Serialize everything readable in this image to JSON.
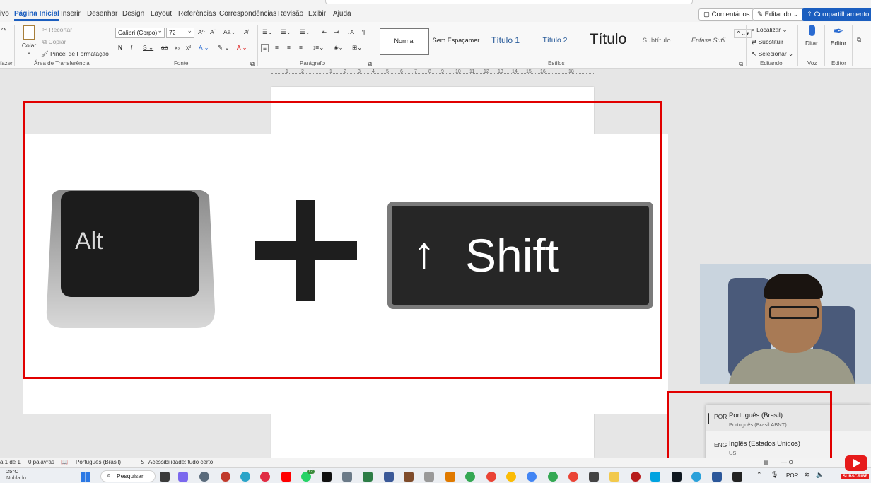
{
  "tabs": [
    "ivo",
    "Página Inicial",
    "Inserir",
    "Desenhar",
    "Design",
    "Layout",
    "Referências",
    "Correspondências",
    "Revisão",
    "Exibir",
    "Ajuda"
  ],
  "ribbon_right": {
    "comments": "Comentários",
    "editing": "Editando",
    "share": "Compartilhamento"
  },
  "clipboard": {
    "paste": "Colar",
    "cut": "Recortar",
    "copy": "Copiar",
    "format_painter": "Pincel de Formatação",
    "group_label": "Área de Transferência",
    "undo_label": "fazer"
  },
  "font": {
    "name": "Calibri (Corpo)",
    "size": "72",
    "group_label": "Fonte"
  },
  "paragraph": {
    "group_label": "Parágrafo"
  },
  "styles": {
    "group_label": "Estilos",
    "items": [
      "Normal",
      "Sem Espaçamer",
      "Título 1",
      "Título 2",
      "Título",
      "Subtítulo",
      "Ênfase Sutil"
    ]
  },
  "editing": {
    "find": "Localizar",
    "replace": "Substituir",
    "select": "Selecionar",
    "group_label": "Editando"
  },
  "voice": {
    "dictate": "Ditar",
    "group_label": "Voz"
  },
  "editor": {
    "label": "Editor",
    "group_label": "Editor"
  },
  "ruler": [
    "1",
    "2",
    "1",
    "2",
    "3",
    "4",
    "5",
    "6",
    "7",
    "8",
    "9",
    "10",
    "11",
    "12",
    "13",
    "14",
    "15",
    "16",
    "18"
  ],
  "keys": {
    "alt": "Alt",
    "shift": "Shift",
    "arrow": "↑"
  },
  "language_menu": [
    {
      "code": "POR",
      "name": "Português (Brasil)",
      "sub": "Português (Brasil ABNT)",
      "selected": true
    },
    {
      "code": "ENG",
      "name": "Inglês (Estados Unidos)",
      "sub": "US",
      "selected": false
    }
  ],
  "status": {
    "page": "a 1 de 1",
    "words": "0 palavras",
    "language": "Português (Brasil)",
    "accessibility": "Acessibilidade: tudo certo"
  },
  "taskbar": {
    "weather_temp": "25°C",
    "weather_desc": "Nublado",
    "search": "Pesquisar",
    "lang": "POR",
    "badge": "12"
  },
  "youtube": {
    "label": "SUBSCRIBE"
  },
  "colors": {
    "accent": "#1b5ebf",
    "highlight_box": "#e10000"
  }
}
